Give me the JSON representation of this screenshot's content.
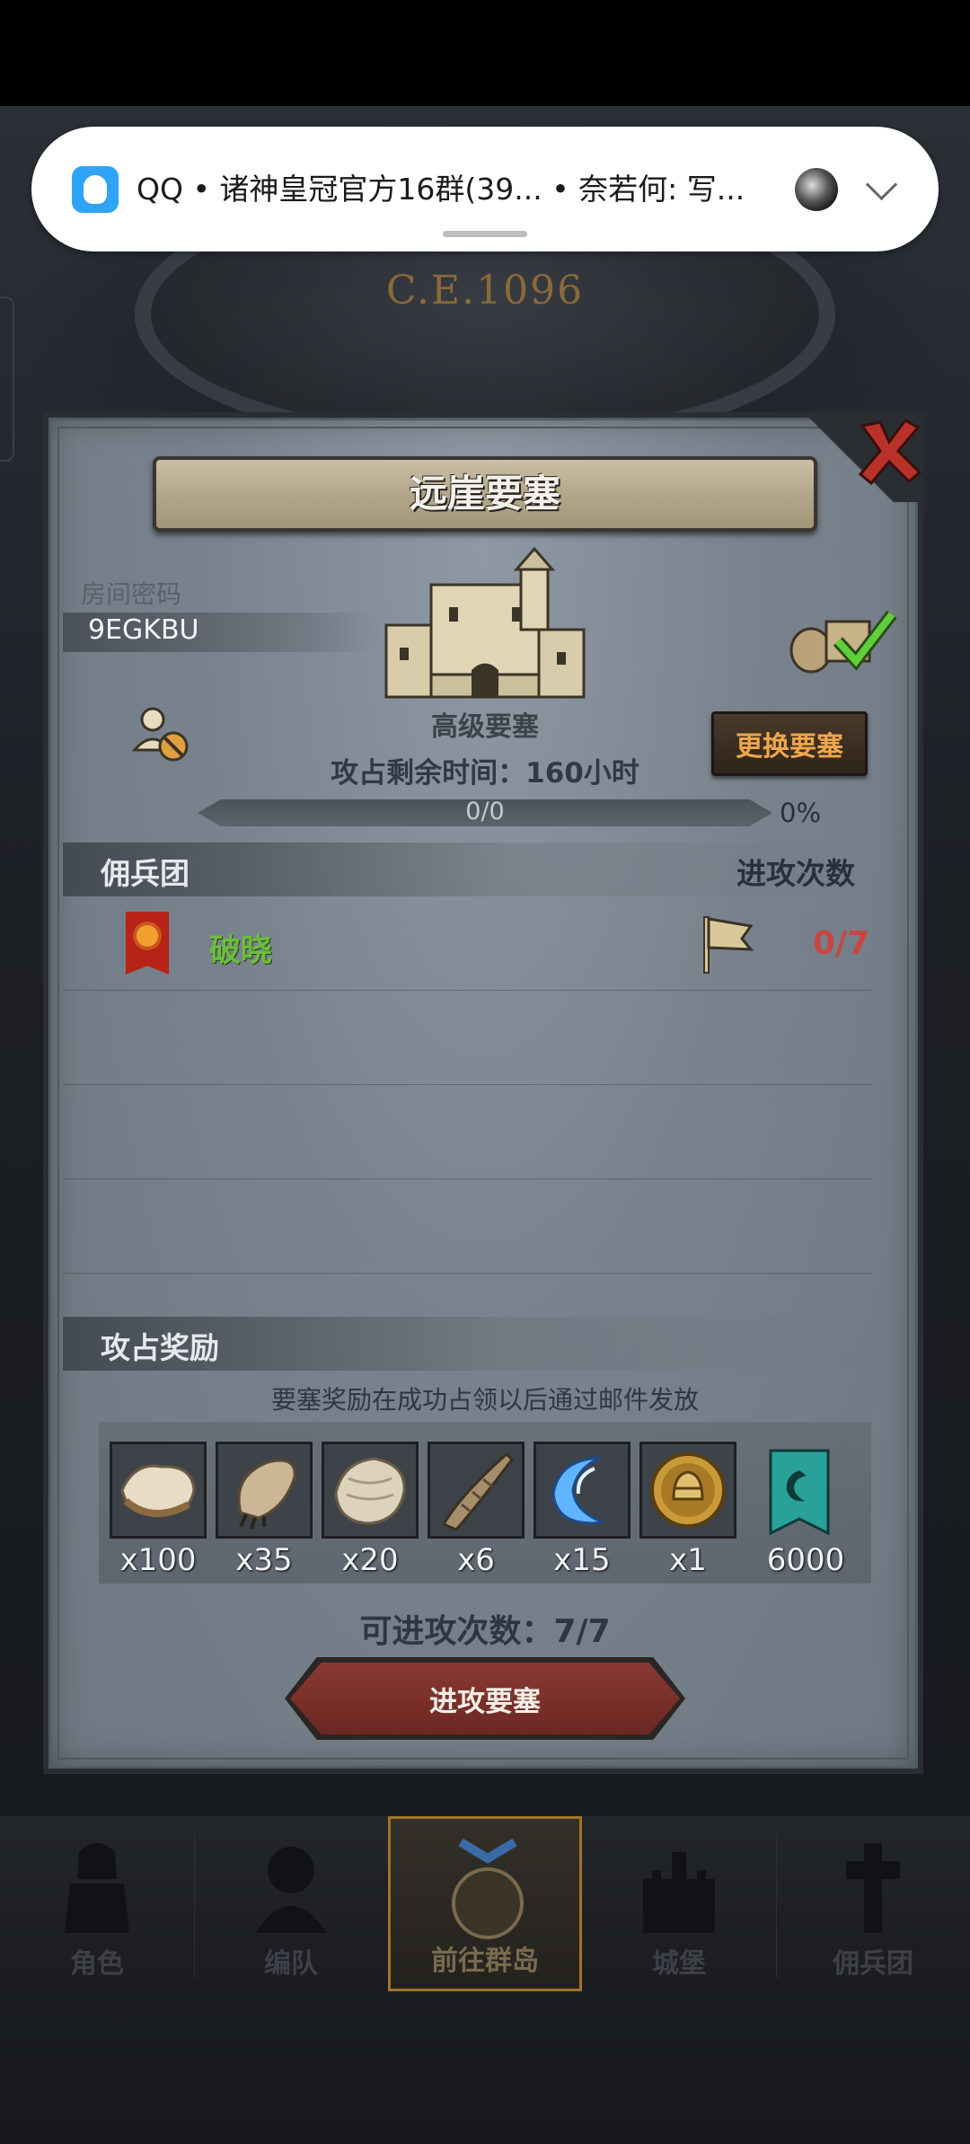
{
  "notification": {
    "app_name": "QQ",
    "text": "QQ • 诸神皇冠官方16群(39...   • 奈若何: 写..."
  },
  "background": {
    "era": "C.E.1096"
  },
  "panel": {
    "title": "远崖要塞",
    "room_password_label": "房间密码",
    "room_password": "9EGKBU",
    "fortress_type": "高级要塞",
    "change_fortress_button": "更换要塞",
    "remaining_time": "攻占剩余时间：160小时",
    "progress": {
      "text": "0/0",
      "percent_label": "0%",
      "fraction": 0
    },
    "mercenary_section": {
      "title": "佣兵团",
      "attacks_header": "进攻次数",
      "rows": [
        {
          "name": "破晓",
          "attacks": "0/7",
          "banner_color": "#b62317"
        }
      ]
    },
    "reward_section": {
      "title": "攻占奖励",
      "note": "要塞奖励在成功占领以后通过邮件发放",
      "items": [
        {
          "icon": "hide-pelt-icon",
          "qty": "x100"
        },
        {
          "icon": "claw-fur-icon",
          "qty": "x35"
        },
        {
          "icon": "fleece-icon",
          "qty": "x20"
        },
        {
          "icon": "horn-icon",
          "qty": "x6"
        },
        {
          "icon": "crescent-crystal-icon",
          "qty": "x15"
        },
        {
          "icon": "helmet-medal-icon",
          "qty": "x1"
        },
        {
          "icon": "guild-banner-icon",
          "qty": "6000"
        }
      ]
    },
    "attempts_left": "可进攻次数：7/7",
    "attack_button": "进攻要塞"
  },
  "bottom_nav": {
    "items": [
      {
        "label": "角色",
        "icon": "knight-icon"
      },
      {
        "label": "编队",
        "icon": "formation-icon"
      },
      {
        "label": "前往群岛",
        "icon": "islands-icon",
        "active": true
      },
      {
        "label": "城堡",
        "icon": "castle-icon"
      },
      {
        "label": "佣兵团",
        "icon": "mercenary-icon"
      }
    ]
  },
  "colors": {
    "accent_gold": "#f0a64a",
    "green_name": "#6dbd3d",
    "red_count": "#c8463f",
    "qq_blue": "#2fa3f5"
  }
}
